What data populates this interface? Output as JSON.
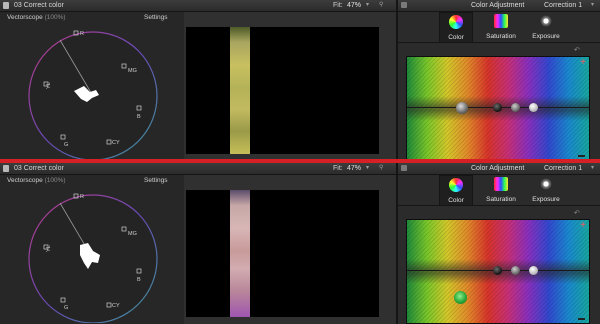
{
  "viewer": {
    "project_title": "03 Correct color",
    "fit_label": "Fit:",
    "zoom": "47%",
    "scope": {
      "name": "Vectorscope",
      "zoom": "(100%)",
      "settings_label": "Settings"
    },
    "targets": {
      "r": "R",
      "mg": "MG",
      "b": "B",
      "cy": "CY",
      "g": "G",
      "yl": "YL"
    }
  },
  "inspector": {
    "title": "Color Adjustment",
    "correction": "Correction 1",
    "tabs": [
      {
        "label": "Color"
      },
      {
        "label": "Saturation"
      },
      {
        "label": "Exposure"
      }
    ],
    "reset_glyph": "↶",
    "add_glyph": "+"
  },
  "colors": {
    "separator": "#d71f26",
    "accent_green": "#2aa83a"
  }
}
